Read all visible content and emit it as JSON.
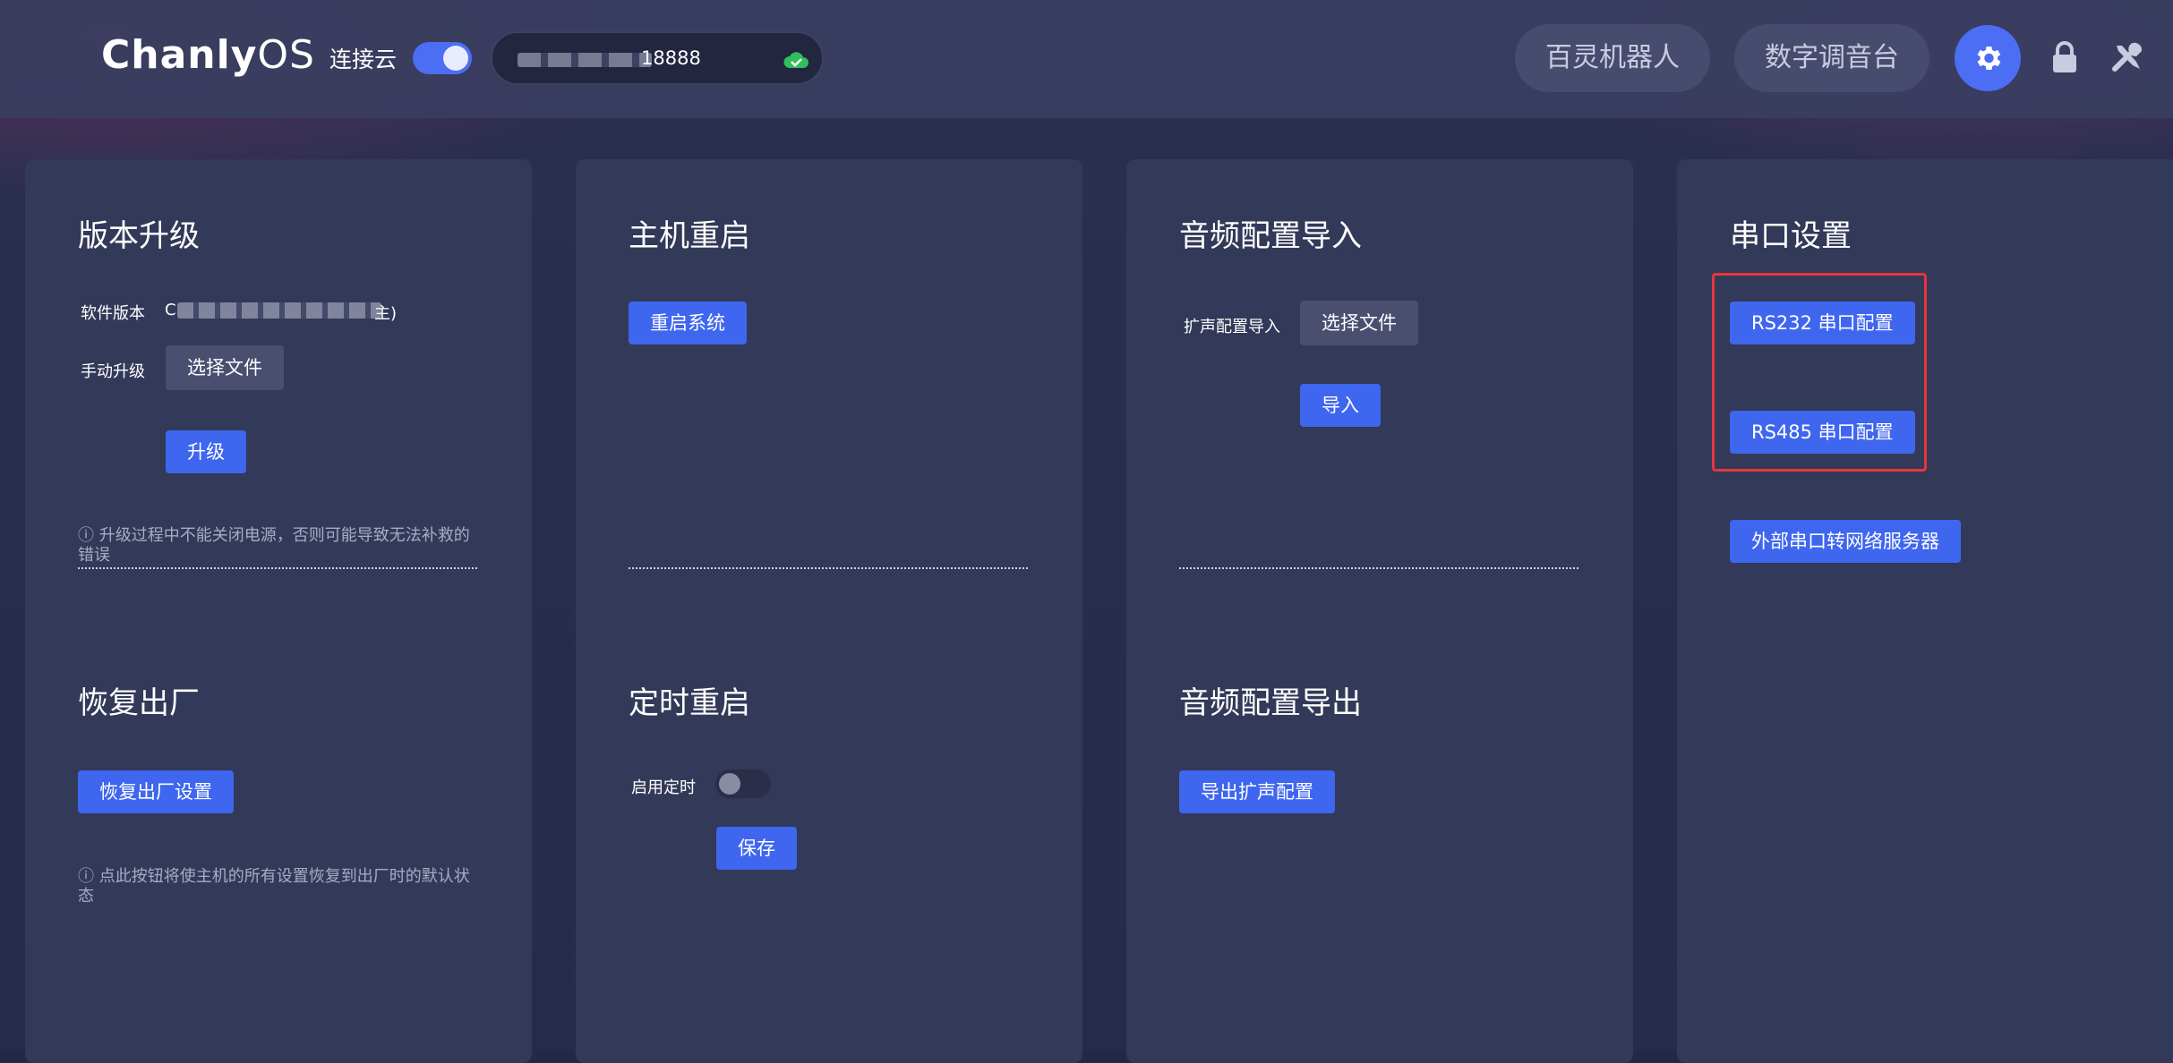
{
  "header": {
    "logo_main": "Chanly",
    "logo_os": "OS",
    "cloud_label": "连接云",
    "device_suffix": "18888",
    "nav_pills": [
      "百灵机器人",
      "数字调音台"
    ],
    "accent_color": "#4c6ef5",
    "icons": [
      "gear-icon",
      "lock-icon",
      "tools-icon",
      "cloud-check-icon"
    ]
  },
  "upgrade": {
    "title": "版本升级",
    "software_version_label": "软件版本",
    "version_prefix": "C",
    "version_suffix": "主)",
    "manual_upgrade_label": "手动升级",
    "choose_file": "选择文件",
    "upgrade_button": "升级",
    "note": "ⓘ 升级过程中不能关闭电源，否则可能导致无法补救的错误"
  },
  "factory": {
    "title": "恢复出厂",
    "button": "恢复出厂设置",
    "note": "ⓘ 点此按钮将使主机的所有设置恢复到出厂时的默认状态"
  },
  "reboot": {
    "title": "主机重启",
    "button": "重启系统"
  },
  "scheduled": {
    "title": "定时重启",
    "enable_label": "启用定时",
    "enabled": false,
    "save_button": "保存"
  },
  "audio_import": {
    "title": "音频配置导入",
    "speaker_import_label": "扩声配置导入",
    "choose_file": "选择文件",
    "import_button": "导入"
  },
  "audio_export": {
    "title": "音频配置导出",
    "export_button": "导出扩声配置"
  },
  "serial": {
    "title": "串口设置",
    "rs232_button": "RS232 串口配置",
    "rs485_button": "RS485 串口配置",
    "external_button": "外部串口转网络服务器",
    "highlight_color": "#e8343b"
  }
}
